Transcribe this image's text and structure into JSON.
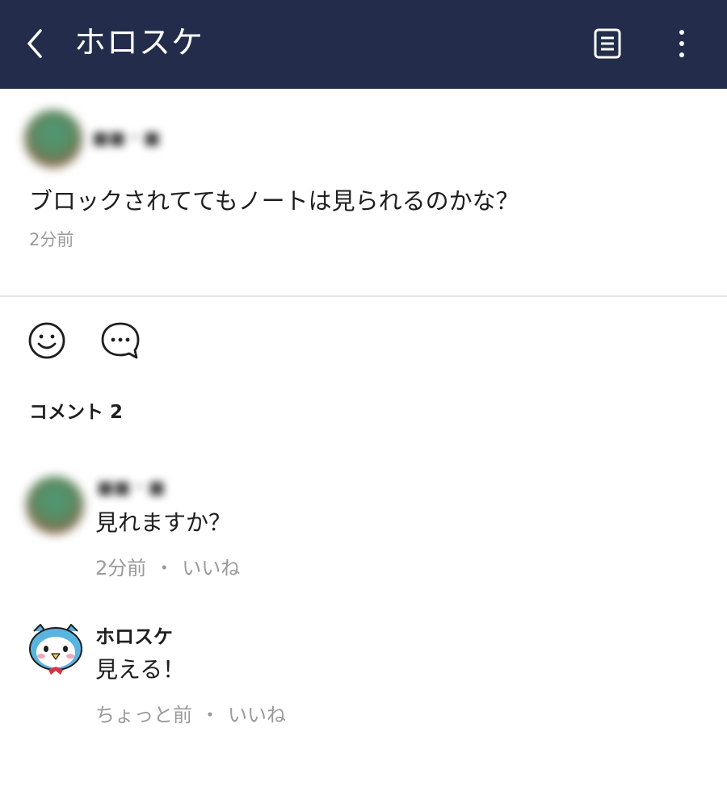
{
  "header": {
    "title": "ホロスケ",
    "back_icon": "chevron-left-icon",
    "note_icon": "document-lines-icon",
    "more_icon": "vertical-dots-icon",
    "bg_color": "#232c4a"
  },
  "post": {
    "author": "■■・■",
    "text": "ブロックされててもノートは見られるのかな？",
    "time": "2分前"
  },
  "actions": {
    "reaction_icon": "smiley-face-icon",
    "comment_icon": "speech-bubble-icon"
  },
  "comments": {
    "heading": "コメント 2",
    "items": [
      {
        "author": "■■・■",
        "text": "見れますか？",
        "time": "2分前",
        "separator": "・",
        "like_label": "いいね"
      },
      {
        "author": "ホロスケ",
        "text": "見える！",
        "time": "ちょっと前",
        "separator": "・",
        "like_label": "いいね"
      }
    ]
  }
}
